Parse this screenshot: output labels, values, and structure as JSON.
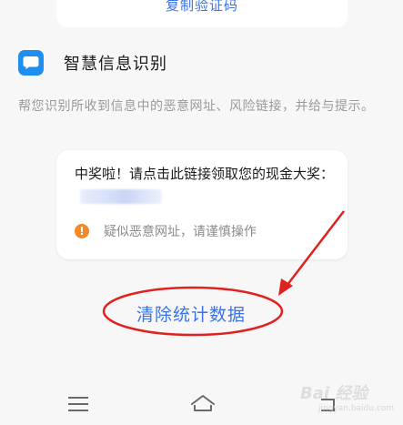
{
  "top_card": {
    "copy_button_label": "复制验证码"
  },
  "feature": {
    "icon": "message-bubble-icon",
    "title": "智慧信息识别",
    "description": "帮您识别所收到信息中的恶意网址、风险链接，并给与提示。"
  },
  "message_card": {
    "message_text": "中奖啦！请点击此链接领取您的现金大奖：",
    "warning_icon": "exclamation-icon",
    "warning_text": "疑似恶意网址，请谨慎操作"
  },
  "actions": {
    "clear_stats_label": "清除统计数据"
  },
  "nav": {
    "menu_icon": "menu-icon",
    "home_icon": "home-icon",
    "back_icon": "back-icon"
  },
  "watermark": {
    "text": "Bai 经验",
    "sub": "jingyan.baidu.com"
  },
  "colors": {
    "accent": "#3a72e8",
    "app_icon": "#1e8ff0",
    "warning": "#f08a2a",
    "annotation": "#e0211e",
    "background": "#f7f7f8"
  }
}
